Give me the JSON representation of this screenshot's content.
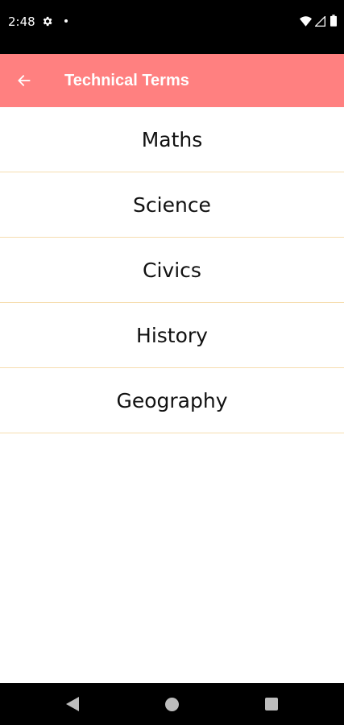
{
  "status_bar": {
    "time": "2:48",
    "icons": [
      "gear-icon",
      "notification-dot-icon",
      "wifi-icon",
      "signal-icon",
      "battery-icon"
    ]
  },
  "app_bar": {
    "title": "Technical Terms",
    "back_icon": "arrow-left-icon",
    "background_color": "#ff8080"
  },
  "subjects": [
    {
      "label": "Maths"
    },
    {
      "label": "Science"
    },
    {
      "label": "Civics"
    },
    {
      "label": "History"
    },
    {
      "label": "Geography"
    }
  ],
  "nav_bar": {
    "icons": [
      "nav-back-icon",
      "nav-home-icon",
      "nav-recents-icon"
    ]
  },
  "colors": {
    "accent": "#ff8080",
    "divider": "#f6ddb0"
  }
}
